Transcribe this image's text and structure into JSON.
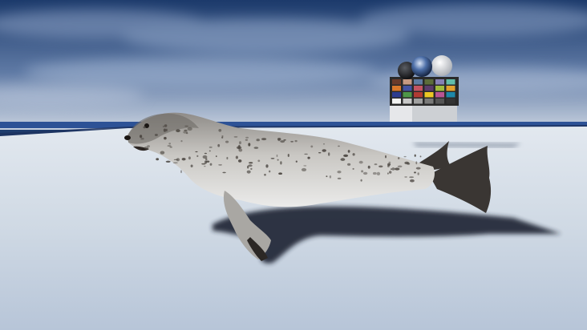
{
  "scene": {
    "subject": "seal",
    "colors": {
      "sky_top": "#1c3a6b",
      "sky_mid": "#6d86ae",
      "sky_horizon": "#c7d1df",
      "floor_far": "#dfe6ee",
      "floor_near": "#b8c6d9",
      "shadow": "#1a2330",
      "seal_light": "#dcdcdc",
      "seal_mid": "#a9a7a3",
      "seal_dark": "#4b4641",
      "flipper": "#3a3633"
    },
    "color_checker": {
      "swatches": [
        "#6b3b2a",
        "#c79a82",
        "#5e7ba1",
        "#5c6d3a",
        "#8581b5",
        "#62bdaa",
        "#d9782b",
        "#4353a3",
        "#c35462",
        "#5b3c6b",
        "#9fbb3d",
        "#e3a12e",
        "#2d3c8f",
        "#4d9648",
        "#b03a33",
        "#ecc724",
        "#b85493",
        "#1e88a8",
        "#f3f3f2",
        "#c8c8c8",
        "#a0a0a0",
        "#7a7a79",
        "#555555",
        "#343434"
      ]
    }
  }
}
